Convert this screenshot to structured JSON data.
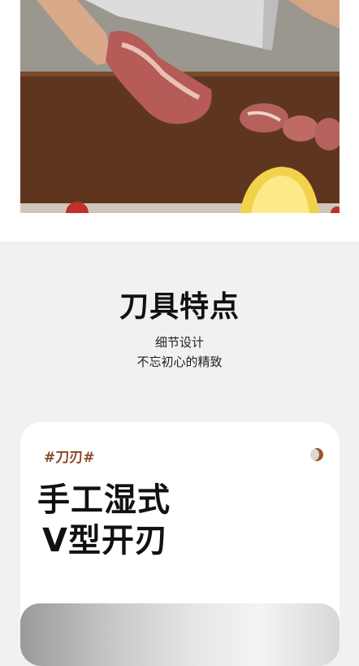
{
  "section": {
    "title": "刀具特点",
    "subtitle_line1": "细节设计",
    "subtitle_line2": "不忘初心的精致"
  },
  "feature_card": {
    "tag": "#刀刃#",
    "title_line1": "手工湿式",
    "title_line2": "V型开刃"
  },
  "colors": {
    "page_bg": "#f1f1f1",
    "tag_color": "#8a4a2a",
    "title_color": "#111111"
  }
}
